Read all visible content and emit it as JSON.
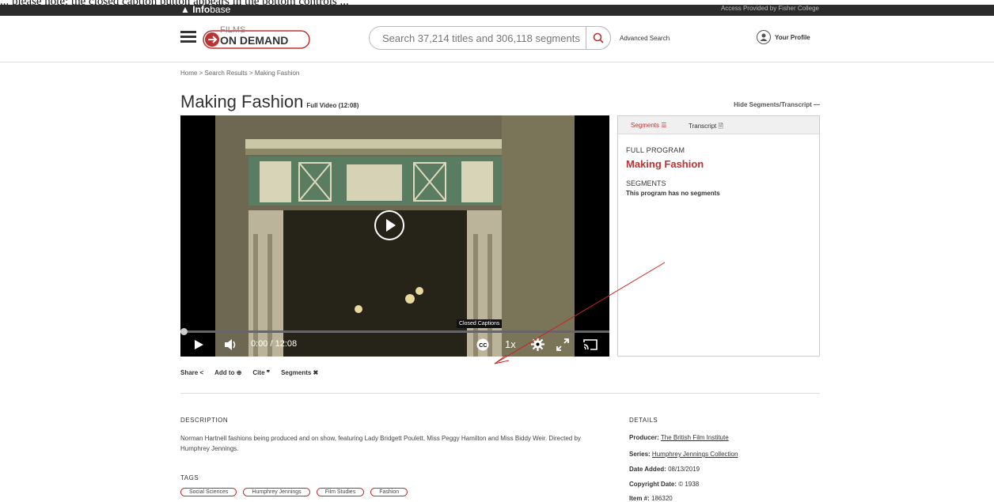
{
  "top_caption": "... please note: the closed caption button appears in the bottom controls ...",
  "banner": {
    "brand_bold": "Info",
    "brand_light": "base",
    "access": "Access Provided by Fisher College"
  },
  "header": {
    "logo_line1": "FILMS",
    "logo_line2": "ON DEMAND",
    "search_placeholder": "Search 37,214 titles and 306,118 segments",
    "advanced_search": "Advanced Search",
    "profile": "Your Profile"
  },
  "breadcrumb": {
    "home": "Home",
    "results": "Search Results",
    "current": "Making Fashion",
    "sep": ">"
  },
  "title": {
    "main": "Making Fashion",
    "sub": "Full Video (12:08)",
    "hide_toggle": "Hide Segments/Transcript —"
  },
  "player": {
    "time_current": "0:00",
    "time_total": "12:08",
    "speed": "1x",
    "cc_tooltip": "Closed Captions",
    "progress": 0
  },
  "segments_panel": {
    "tab_segments": "Segments",
    "tab_transcript": "Transcript",
    "full_program_label": "FULL PROGRAM",
    "full_program_title": "Making Fashion",
    "segments_label": "SEGMENTS",
    "no_segments": "This program has no segments"
  },
  "actions": {
    "share": "Share",
    "add_to": "Add to",
    "cite": "Cite",
    "segments": "Segments"
  },
  "description": {
    "heading": "DESCRIPTION",
    "text": "Norman Hartnell fashions being produced and on show, featuring Lady Bridgett Poulett, Miss Peggy Hamilton and Miss Biddy Weir. Directed by Humphrey Jennings."
  },
  "tags": {
    "heading": "TAGS",
    "items": [
      "Social Sciences",
      "Humphrey Jennings",
      "Film Studies",
      "Fashion"
    ]
  },
  "details": {
    "heading": "DETAILS",
    "producer_label": "Producer:",
    "producer": "The British Film Institute",
    "series_label": "Series:",
    "series": "Humphrey Jennings Collection",
    "date_added_label": "Date Added:",
    "date_added": "08/13/2019",
    "copyright_label": "Copyright Date:",
    "copyright": "© 1938",
    "item_label": "Item #:",
    "item": "186320"
  },
  "colors": {
    "accent": "#b33333",
    "banner": "#2b2b2b",
    "annotation": "#cc2222"
  }
}
